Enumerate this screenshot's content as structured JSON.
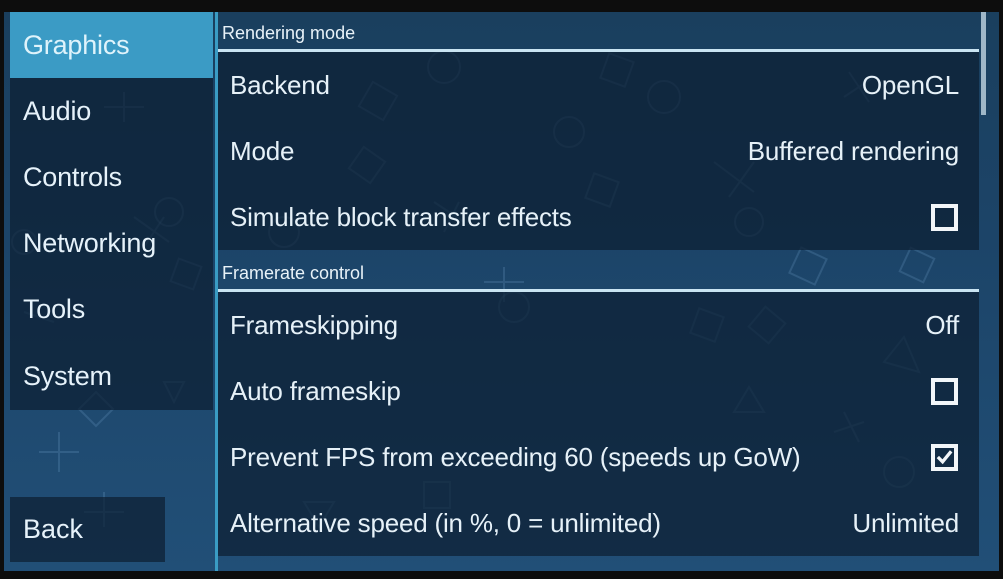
{
  "sidebar": {
    "items": [
      {
        "label": "Graphics",
        "active": true
      },
      {
        "label": "Audio",
        "active": false
      },
      {
        "label": "Controls",
        "active": false
      },
      {
        "label": "Networking",
        "active": false
      },
      {
        "label": "Tools",
        "active": false
      },
      {
        "label": "System",
        "active": false
      }
    ],
    "back_label": "Back"
  },
  "colors": {
    "accent": "#3b9bc5",
    "panel": "#0d1e32",
    "background": "#1c4468"
  },
  "groups": [
    {
      "header": "Rendering mode",
      "rows": [
        {
          "label": "Backend",
          "type": "value",
          "value": "OpenGL"
        },
        {
          "label": "Mode",
          "type": "value",
          "value": "Buffered rendering"
        },
        {
          "label": "Simulate block transfer effects",
          "type": "checkbox",
          "checked": false
        }
      ]
    },
    {
      "header": "Framerate control",
      "rows": [
        {
          "label": "Frameskipping",
          "type": "value",
          "value": "Off"
        },
        {
          "label": "Auto frameskip",
          "type": "checkbox",
          "checked": false
        },
        {
          "label": "Prevent FPS from exceeding 60 (speeds up GoW)",
          "type": "checkbox",
          "checked": true
        },
        {
          "label": "Alternative speed (in %, 0 = unlimited)",
          "type": "value",
          "value": "Unlimited"
        }
      ]
    }
  ]
}
